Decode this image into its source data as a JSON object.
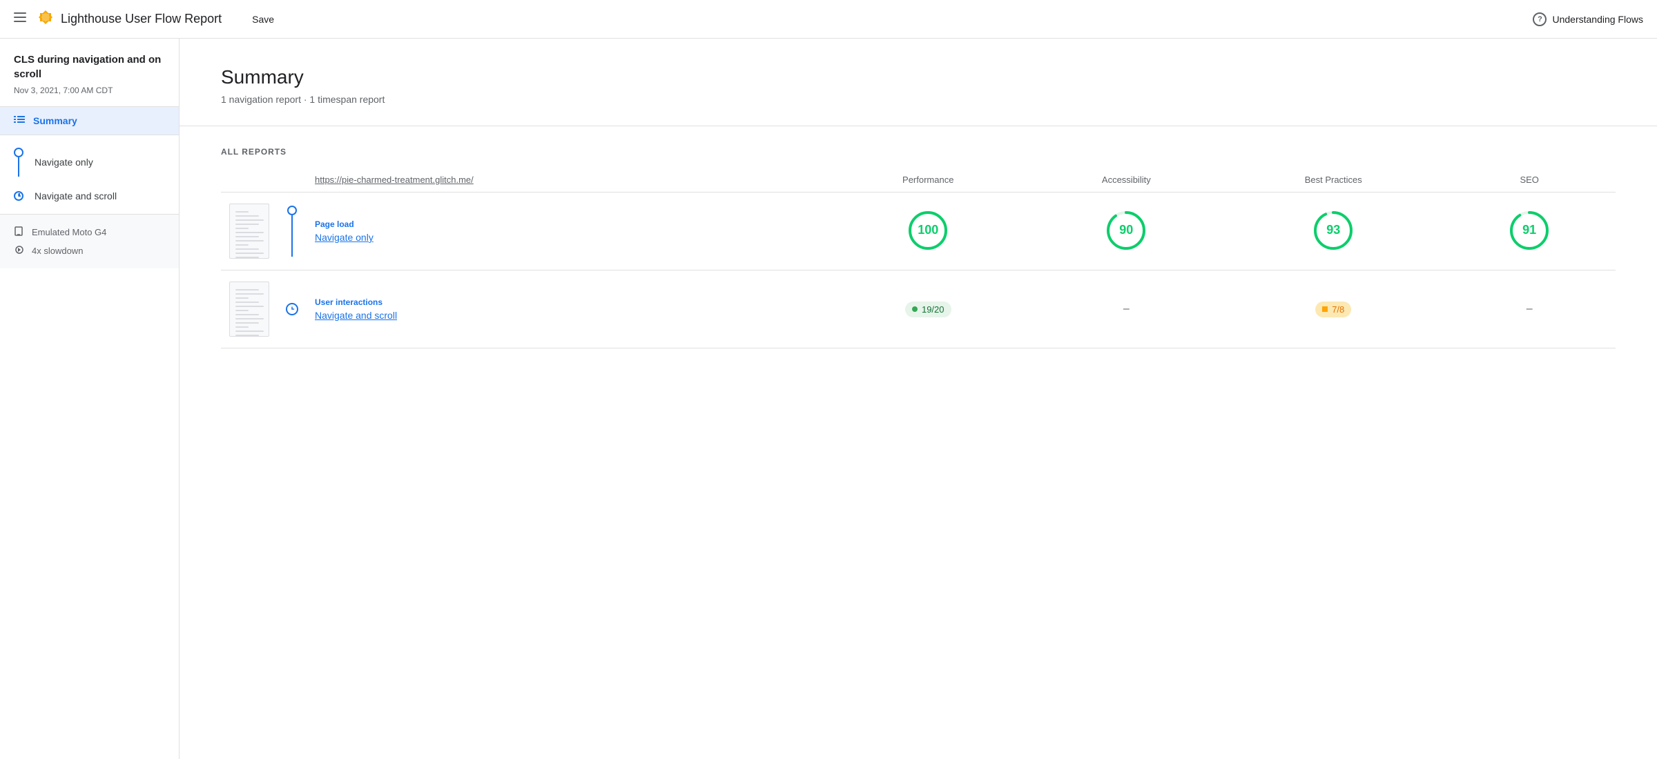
{
  "header": {
    "menu_label": "☰",
    "logo": "🏠",
    "title": "Lighthouse User Flow Report",
    "save_label": "Save",
    "understanding_label": "Understanding Flows"
  },
  "sidebar": {
    "project_title": "CLS during navigation and on scroll",
    "project_date": "Nov 3, 2021, 7:00 AM CDT",
    "summary_label": "Summary",
    "flows": [
      {
        "id": "navigate-only",
        "label": "Navigate only",
        "type": "circle"
      },
      {
        "id": "navigate-scroll",
        "label": "Navigate and scroll",
        "type": "clock"
      }
    ],
    "device": {
      "items": [
        {
          "icon": "🖥",
          "label": "Emulated Moto G4"
        },
        {
          "icon": "⚙",
          "label": "4x slowdown"
        }
      ]
    }
  },
  "summary": {
    "title": "Summary",
    "subtitle": "1 navigation report · 1 timespan report",
    "all_reports_label": "ALL REPORTS",
    "table": {
      "columns": [
        {
          "id": "url",
          "label": "https://pie-charmed-treatment.glitch.me/"
        },
        {
          "id": "performance",
          "label": "Performance"
        },
        {
          "id": "accessibility",
          "label": "Accessibility"
        },
        {
          "id": "best_practices",
          "label": "Best Practices"
        },
        {
          "id": "seo",
          "label": "SEO"
        }
      ],
      "rows": [
        {
          "id": "row-navigate-only",
          "connector_type": "circle",
          "type_label": "Page load",
          "name": "Navigate only",
          "scores": {
            "performance": {
              "value": 100,
              "type": "circle",
              "color": "green"
            },
            "accessibility": {
              "value": 90,
              "type": "circle",
              "color": "green"
            },
            "best_practices": {
              "value": 93,
              "type": "circle",
              "color": "green"
            },
            "seo": {
              "value": 91,
              "type": "circle",
              "color": "green"
            }
          }
        },
        {
          "id": "row-navigate-scroll",
          "connector_type": "clock",
          "type_label": "User interactions",
          "name": "Navigate and scroll",
          "scores": {
            "performance": {
              "value": "19/20",
              "type": "pill-green"
            },
            "accessibility": {
              "value": "–",
              "type": "dash"
            },
            "best_practices": {
              "value": "7/8",
              "type": "pill-orange"
            },
            "seo": {
              "value": "–",
              "type": "dash"
            }
          }
        }
      ]
    }
  }
}
